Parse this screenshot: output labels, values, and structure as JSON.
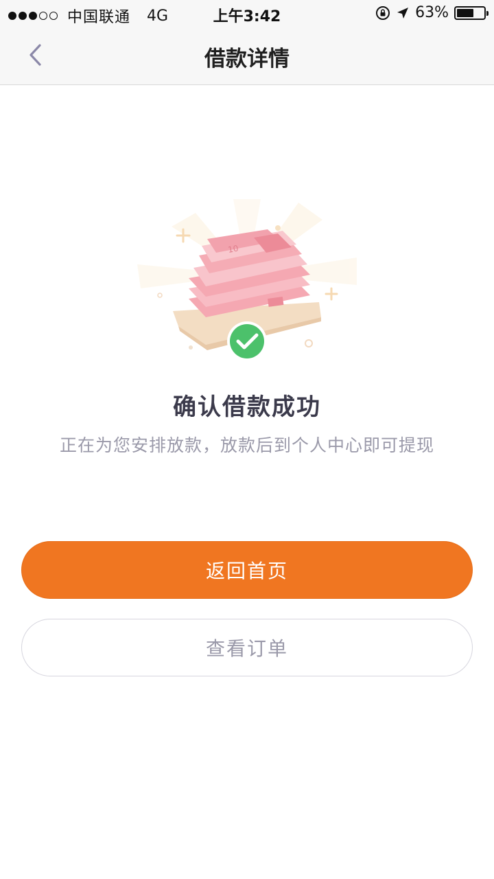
{
  "status_bar": {
    "carrier": "中国联通",
    "network": "4G",
    "time": "上午3:42",
    "battery": "63%",
    "battery_level": 0.63
  },
  "nav": {
    "title": "借款详情",
    "back_icon": "chevron-left-icon"
  },
  "illustration": {
    "name": "money-stack-illustration",
    "check_icon": "check-circle-icon",
    "accent_color": "#4cc16b"
  },
  "result": {
    "title": "确认借款成功",
    "subtitle": "正在为您安排放款，放款后到个人中心即可提现"
  },
  "actions": {
    "home_label": "返回首页",
    "orders_label": "查看订单"
  },
  "colors": {
    "primary": "#f07621",
    "text_dark": "#3b3a4b",
    "text_muted": "#9a99a9"
  }
}
